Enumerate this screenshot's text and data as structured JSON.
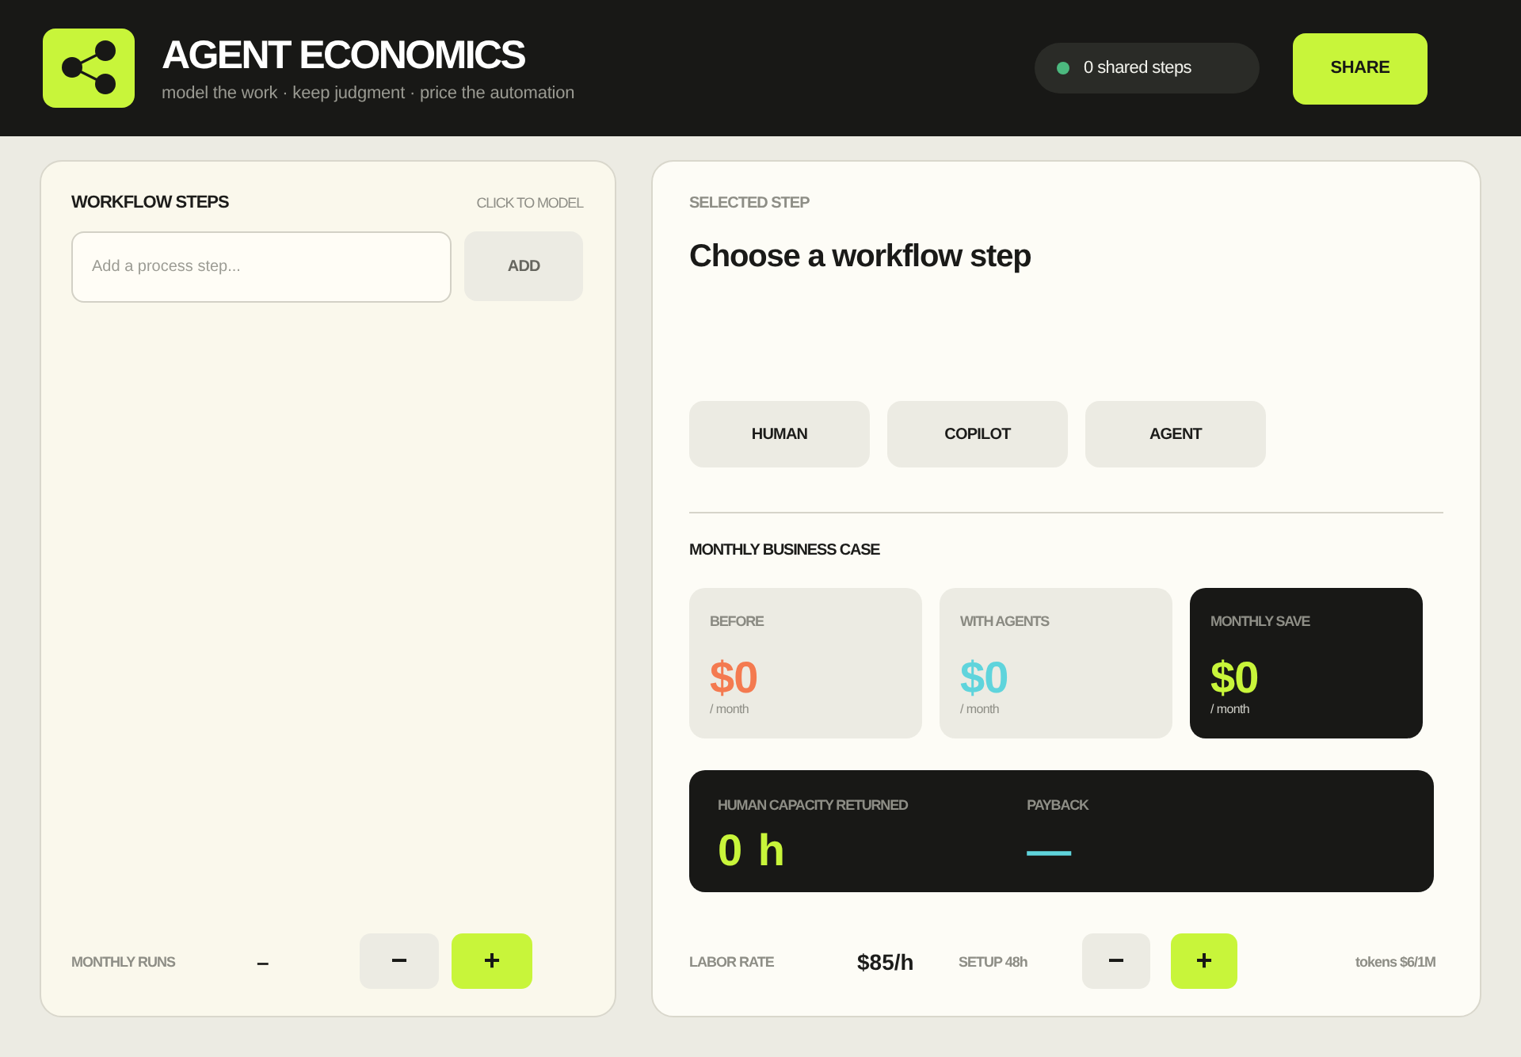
{
  "header": {
    "title": "AGENT ECONOMICS",
    "subtitle": "model the work · keep judgment · price the automation",
    "status": "0 shared steps",
    "share_button": "SHARE"
  },
  "workflow": {
    "title": "WORKFLOW STEPS",
    "hint": "CLICK TO MODEL",
    "step_input": {
      "placeholder": "Add a process step..."
    },
    "add_button": "ADD",
    "runs": {
      "label": "MONTHLY RUNS",
      "value": "–",
      "decrement": "−",
      "increment": "+"
    }
  },
  "selected_step": {
    "label": "SELECTED STEP",
    "title": "Choose a workflow step",
    "modes": [
      {
        "label": "HUMAN",
        "selected": false
      },
      {
        "label": "COPILOT",
        "selected": false
      },
      {
        "label": "AGENT",
        "selected": false
      }
    ]
  },
  "business_case": {
    "title": "MONTHLY BUSINESS CASE",
    "cards": [
      {
        "label": "BEFORE",
        "value": "$0",
        "unit": "/ month",
        "color": "#f47a50",
        "highlighted": false
      },
      {
        "label": "WITH AGENTS",
        "value": "$0",
        "unit": "/ month",
        "color": "#5fd4dc",
        "highlighted": false
      },
      {
        "label": "MONTHLY SAVE",
        "value": "$0",
        "unit": "/ month",
        "color": "#c8f53a",
        "highlighted": true
      }
    ],
    "capacity": [
      {
        "label": "HUMAN CAPACITY RETURNED",
        "value": "0 h",
        "color": "#c8f53a"
      },
      {
        "label": "PAYBACK",
        "value": "—",
        "color": "#5fd4dc"
      }
    ],
    "controls": {
      "rate_label": "LABOR RATE",
      "rate_value": "$85/h",
      "setup_label": "SETUP 48h",
      "decrement": "−",
      "increment": "+",
      "tokens": "tokens $6/1M"
    }
  }
}
